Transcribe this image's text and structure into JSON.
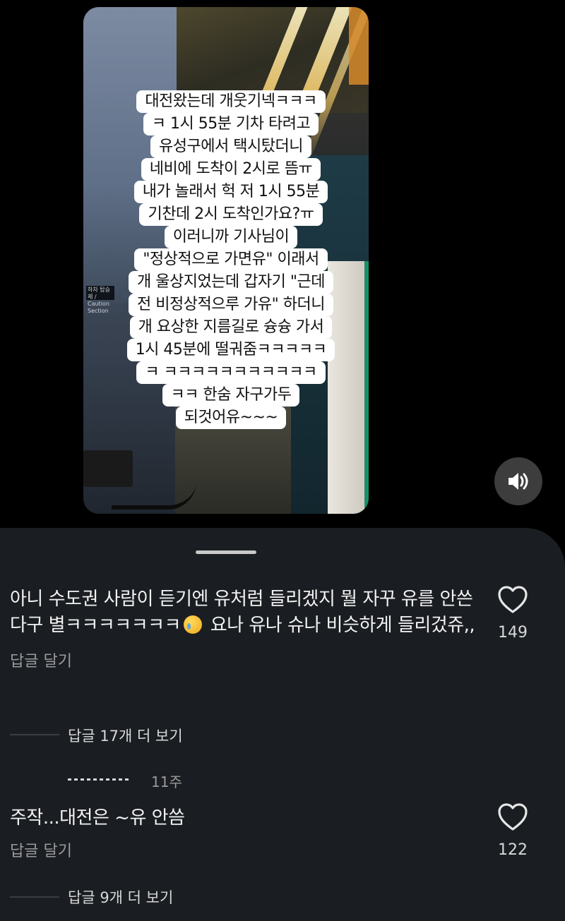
{
  "video": {
    "sign_text": "하차 탑승제 / Caution Section",
    "caption_lines": [
      "대전왔는데 개웃기넥ㅋㅋㅋ",
      "ㅋ 1시 55분 기차 타려고",
      "유성구에서 택시탔더니",
      "네비에 도착이 2시로 뜸ㅠ",
      "내가 놀래서 헉 저 1시 55분",
      "기찬데 2시 도착인가요?ㅠ",
      "이러니까 기사님이",
      "\"정상적으로 가면유\" 이래서",
      "개 울상지었는데 갑자기 \"근데",
      "전 비정상적으루 가유\" 하더니",
      "개 요상한 지름길로 슝슝 가서",
      "1시 45분에 떨궈줌ㅋㅋㅋㅋㅋ",
      "ㅋ ㅋㅋㅋㅋㅋㅋㅋㅋㅋㅋㅋ",
      "ㅋㅋ 한숨 자구가두",
      "되것어유~~~"
    ],
    "sound_icon": "speaker-icon"
  },
  "comments": [
    {
      "text_before_emoji": "아니 수도권 사람이 듣기엔 유처럼 들리겠지 뭘 자꾸 유를 안쓴다구 별ㅋㅋㅋㅋㅋㅋㅋ",
      "text_after_emoji": " 요나 유나 슈나 비슷하게 들리겄쥬,,",
      "emoji": "crying-face",
      "reply_label": "답글 달기",
      "likes": "149",
      "more_replies": "답글 17개 더 보기"
    },
    {
      "text": "주작...대전은 ~유 안씀",
      "reply_label": "답글 달기",
      "likes": "122",
      "age": "11주",
      "more_replies": "답글 9개 더 보기"
    }
  ],
  "colors": {
    "sheet_bg": "#1a1d21",
    "page_bg": "#000000",
    "muted_text": "#9b9b9b"
  }
}
